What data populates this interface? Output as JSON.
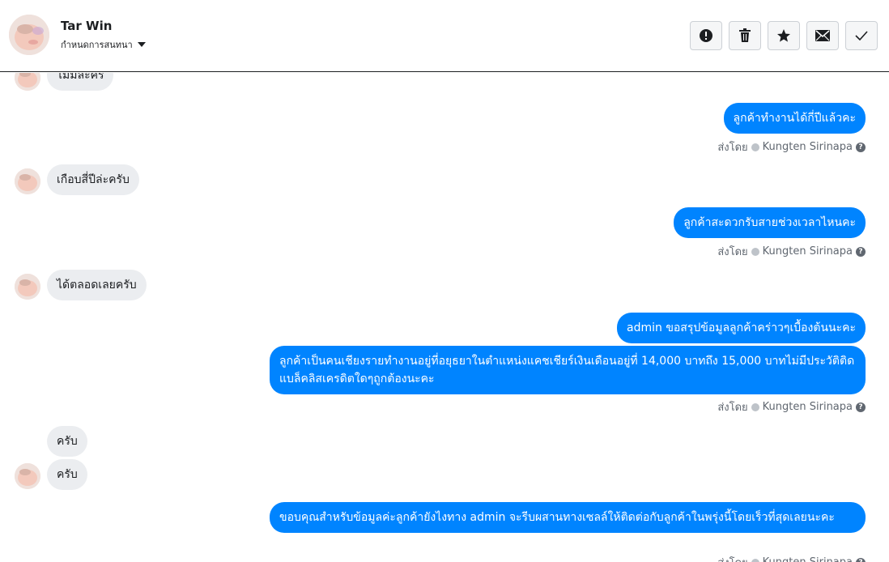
{
  "header": {
    "name": "Tar Win",
    "subtitle": "กำหนดการสนทนา",
    "actions": [
      {
        "icon": "alert-icon"
      },
      {
        "icon": "trash-icon"
      },
      {
        "icon": "star-icon"
      },
      {
        "icon": "mail-icon"
      },
      {
        "icon": "check-icon"
      }
    ]
  },
  "messages": {
    "m0": "ไม่มีละคร",
    "m1": "ลูกค้าทำงานได้กี่ปีแล้วคะ",
    "m2": "เกือบสี่ปีล่ะครับ",
    "m3": "ลูกค้าสะดวกรับสายช่วงเวลาไหนคะ",
    "m4": "ได้ตลอดเลยครับ",
    "m5": "admin ขอสรุปข้อมูลลูกค้าคร่าวๆเบื้องต้นนะคะ",
    "m6": "ลูกค้าเป็นคนเชียงรายทำงานอยู่ที่อยุธยาในตำแหน่งแคชเชียร์เงินเดือนอยู่ที่ 14,000 บาทถึง 15,000 บาทไม่มีประวัติติดแบล็คลิสเครดิตใดๆถูกต้องนะคะ",
    "m7": "ครับ",
    "m8": "ครับ",
    "m9": "ขอบคุณสำหรับข้อมูลค่ะลูกค้ายังไงทาง admin จะรีบผสานทางเซลล์ให้ติดต่อกับลูกค้าในพรุ่งนี้โดยเร็วที่สุดเลยนะคะ"
  },
  "sent_by": {
    "prefix": "ส่งโดย",
    "agent": "Kungten Sirinapa",
    "help": "?"
  }
}
